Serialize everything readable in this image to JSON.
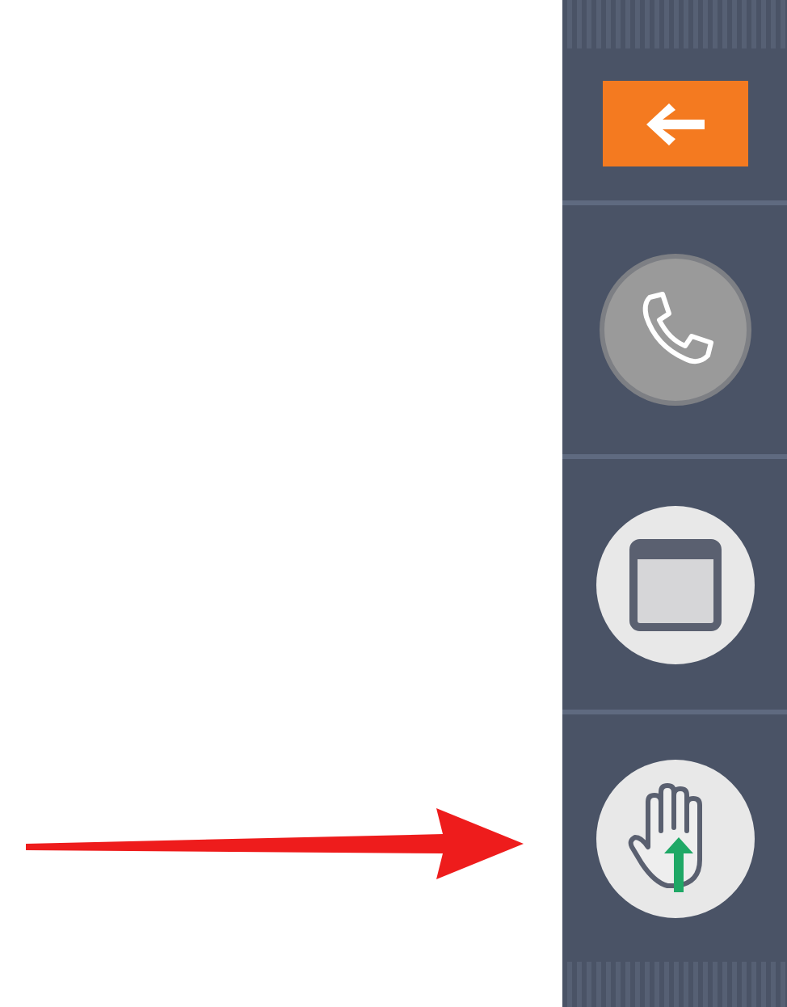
{
  "annotation": {
    "kind": "arrow"
  },
  "sidebar": {
    "items": [
      {
        "kind": "back"
      },
      {
        "kind": "call"
      },
      {
        "kind": "window"
      },
      {
        "kind": "hand"
      }
    ]
  }
}
